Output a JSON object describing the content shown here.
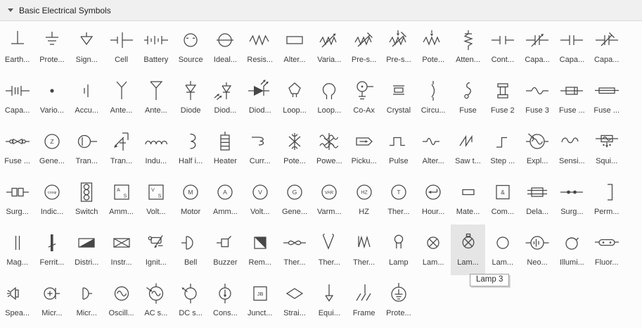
{
  "header": {
    "collapse_icon": "triangle-down",
    "title": "Basic Electrical Symbols"
  },
  "tooltip": {
    "text": "Lamp 3"
  },
  "colors": {
    "header_bg": "#f0f0f0",
    "panel_bg": "#fcfcfc",
    "symbol_stroke": "#474747",
    "label_color": "#3c3c3c",
    "highlight_bg": "#e5e5e5"
  },
  "grid": {
    "columns": 18,
    "rows": 6
  },
  "items": [
    {
      "label": "Earth...",
      "icon": "earth"
    },
    {
      "label": "Prote...",
      "icon": "protective-earth"
    },
    {
      "label": "Sign...",
      "icon": "signal-ground"
    },
    {
      "label": "Cell",
      "icon": "cell"
    },
    {
      "label": "Battery",
      "icon": "battery"
    },
    {
      "label": "Source",
      "icon": "source"
    },
    {
      "label": "Ideal...",
      "icon": "ideal-source"
    },
    {
      "label": "Resis...",
      "icon": "resistor"
    },
    {
      "label": "Alter...",
      "icon": "alt-resistor"
    },
    {
      "label": "Varia...",
      "icon": "variable-resistor"
    },
    {
      "label": "Pre-s...",
      "icon": "preset-resistor"
    },
    {
      "label": "Pre-s...",
      "icon": "preset-resistor-2"
    },
    {
      "label": "Pote...",
      "icon": "potentiometer"
    },
    {
      "label": "Atten...",
      "icon": "attenuator"
    },
    {
      "label": "Cont...",
      "icon": "contact-capacitor"
    },
    {
      "label": "Capa...",
      "icon": "variable-capacitor"
    },
    {
      "label": "Capa...",
      "icon": "capacitor"
    },
    {
      "label": "Capa...",
      "icon": "trimmer-capacitor"
    },
    {
      "label": "Capa...",
      "icon": "polarized-capacitor"
    },
    {
      "label": "Vario...",
      "icon": "dot"
    },
    {
      "label": "Accu...",
      "icon": "accumulator"
    },
    {
      "label": "Ante...",
      "icon": "antenna"
    },
    {
      "label": "Ante...",
      "icon": "antenna-2"
    },
    {
      "label": "Diode",
      "icon": "diode"
    },
    {
      "label": "Diod...",
      "icon": "photodiode"
    },
    {
      "label": "Diod...",
      "icon": "led"
    },
    {
      "label": "Loop...",
      "icon": "loop-antenna"
    },
    {
      "label": "Loop...",
      "icon": "loop-antenna-2"
    },
    {
      "label": "Co-Ax",
      "icon": "coax"
    },
    {
      "label": "Crystal",
      "icon": "crystal"
    },
    {
      "label": "Circu...",
      "icon": "circuit-breaker"
    },
    {
      "label": "Fuse",
      "icon": "fuse"
    },
    {
      "label": "Fuse 2",
      "icon": "fuse-2"
    },
    {
      "label": "Fuse 3",
      "icon": "fuse-3"
    },
    {
      "label": "Fuse ...",
      "icon": "fuse-4"
    },
    {
      "label": "Fuse ...",
      "icon": "fuse-5"
    },
    {
      "label": "Fuse ...",
      "icon": "fuse-6"
    },
    {
      "label": "Gene...",
      "icon": "circle-letter",
      "name": "generator-z",
      "glyph": "Z"
    },
    {
      "label": "Tran...",
      "icon": "transducer"
    },
    {
      "label": "Tran...",
      "icon": "transistor"
    },
    {
      "label": "Indu...",
      "icon": "inductor"
    },
    {
      "label": "Half i...",
      "icon": "half-inductor"
    },
    {
      "label": "Heater",
      "icon": "heater"
    },
    {
      "label": "Curr...",
      "icon": "current-limiter"
    },
    {
      "label": "Pote...",
      "icon": "potential-transformer"
    },
    {
      "label": "Powe...",
      "icon": "power-transformer"
    },
    {
      "label": "Picku...",
      "icon": "pickup"
    },
    {
      "label": "Pulse",
      "icon": "pulse"
    },
    {
      "label": "Alter...",
      "icon": "alternating-pulse"
    },
    {
      "label": "Saw t...",
      "icon": "sawtooth"
    },
    {
      "label": "Step ...",
      "icon": "step"
    },
    {
      "label": "Expl...",
      "icon": "explosive"
    },
    {
      "label": "Sensi...",
      "icon": "sensing"
    },
    {
      "label": "Squi...",
      "icon": "squib"
    },
    {
      "label": "Surg...",
      "icon": "surge-protector"
    },
    {
      "label": "Indic...",
      "icon": "circle-letter",
      "name": "indicator-cos",
      "glyph": "cosφ"
    },
    {
      "label": "Switch",
      "icon": "switch"
    },
    {
      "label": "Amm...",
      "icon": "square-meter",
      "name": "ammeter-shunt",
      "glyph": "A",
      "glyph2": "S"
    },
    {
      "label": "Volt...",
      "icon": "square-meter",
      "name": "voltmeter-shunt",
      "glyph": "V",
      "glyph2": "S"
    },
    {
      "label": "Motor",
      "icon": "circle-letter",
      "name": "motor",
      "glyph": "M"
    },
    {
      "label": "Amm...",
      "icon": "circle-letter",
      "name": "ammeter",
      "glyph": "A"
    },
    {
      "label": "Volt...",
      "icon": "circle-letter",
      "name": "voltmeter",
      "glyph": "V"
    },
    {
      "label": "Gene...",
      "icon": "circle-letter",
      "name": "generator",
      "glyph": "G"
    },
    {
      "label": "Varm...",
      "icon": "circle-letter",
      "name": "varmeter",
      "glyph": "VAR"
    },
    {
      "label": "HZ",
      "icon": "circle-letter",
      "name": "hz-meter",
      "glyph": "HZ"
    },
    {
      "label": "Ther...",
      "icon": "circle-letter",
      "name": "thermometer",
      "glyph": "T"
    },
    {
      "label": "Hour...",
      "icon": "hour-meter"
    },
    {
      "label": "Mate...",
      "icon": "material"
    },
    {
      "label": "Com...",
      "icon": "square-letter",
      "name": "combiner",
      "glyph": "&"
    },
    {
      "label": "Dela...",
      "icon": "delay"
    },
    {
      "label": "Surg...",
      "icon": "surge-arrester"
    },
    {
      "label": "Perm...",
      "icon": "permanent-magnet"
    },
    {
      "label": "Mag...",
      "icon": "magnetic-core"
    },
    {
      "label": "Ferrit...",
      "icon": "ferrite-core"
    },
    {
      "label": "Distri...",
      "icon": "distribution"
    },
    {
      "label": "Instr...",
      "icon": "instrument"
    },
    {
      "label": "Ignit...",
      "icon": "igniter"
    },
    {
      "label": "Bell",
      "icon": "bell"
    },
    {
      "label": "Buzzer",
      "icon": "buzzer"
    },
    {
      "label": "Rem...",
      "icon": "remote"
    },
    {
      "label": "Ther...",
      "icon": "thermistor"
    },
    {
      "label": "Ther...",
      "icon": "thermocouple"
    },
    {
      "label": "Ther...",
      "icon": "thermopile"
    },
    {
      "label": "Lamp",
      "icon": "lamp"
    },
    {
      "label": "Lam...",
      "icon": "lamp-2"
    },
    {
      "label": "Lam...",
      "icon": "lamp-3",
      "highlighted": true
    },
    {
      "label": "Lam...",
      "icon": "lamp-4"
    },
    {
      "label": "Neo...",
      "icon": "neon-lamp"
    },
    {
      "label": "Illumi...",
      "icon": "illuminated"
    },
    {
      "label": "Fluor...",
      "icon": "fluorescent"
    },
    {
      "label": "Spea...",
      "icon": "speaker"
    },
    {
      "label": "Micr...",
      "icon": "microphone"
    },
    {
      "label": "Micr...",
      "icon": "microphone-2"
    },
    {
      "label": "Oscill...",
      "icon": "oscillator"
    },
    {
      "label": "AC s...",
      "icon": "ac-source"
    },
    {
      "label": "DC s...",
      "icon": "dc-source"
    },
    {
      "label": "Cons...",
      "icon": "constant-current"
    },
    {
      "label": "Junct...",
      "icon": "square-letter",
      "name": "junction-box",
      "glyph": "JB"
    },
    {
      "label": "Strai...",
      "icon": "straight-joint"
    },
    {
      "label": "Equi...",
      "icon": "equipotential"
    },
    {
      "label": "Frame",
      "icon": "frame-ground"
    },
    {
      "label": "Prote...",
      "icon": "protective-earth-2"
    }
  ]
}
